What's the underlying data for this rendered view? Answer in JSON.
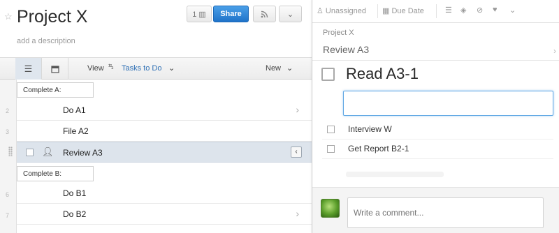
{
  "project": {
    "title": "Project X",
    "description_placeholder": "add a description",
    "share_label": "Share"
  },
  "toolbar": {
    "view_label": "View",
    "sort_glyph": "¹²₃",
    "filter_label": "Tasks to Do",
    "new_label": "New"
  },
  "sections": [
    {
      "label": "Complete A:"
    },
    {
      "label": "Complete B:"
    }
  ],
  "row_numbers": [
    "2",
    "3",
    "5",
    "6",
    "7"
  ],
  "tasks": [
    {
      "name": "Do A1"
    },
    {
      "name": "File A2"
    },
    {
      "name": "Review A3"
    },
    {
      "name": "Do B1"
    },
    {
      "name": "Do B2"
    }
  ],
  "detail": {
    "assignee_label": "Unassigned",
    "due_label": "Due Date",
    "breadcrumb_project": "Project X",
    "breadcrumb_parent": "Review A3",
    "task_title": "Read A3-1",
    "subtasks": [
      {
        "label": "Interview W"
      },
      {
        "label": "Get Report B2-1"
      }
    ],
    "comment_placeholder": "Write a comment..."
  },
  "icons": {
    "star": "star-icon",
    "list_view": "list-icon",
    "calendar_view": "calendar-icon",
    "rss": "rss-icon",
    "user": "user-icon"
  },
  "colors": {
    "accent": "#2d6fb4",
    "share_button": "#1f73c9",
    "selected_row": "#dde4ec",
    "focus_border": "#5fa7e4"
  }
}
